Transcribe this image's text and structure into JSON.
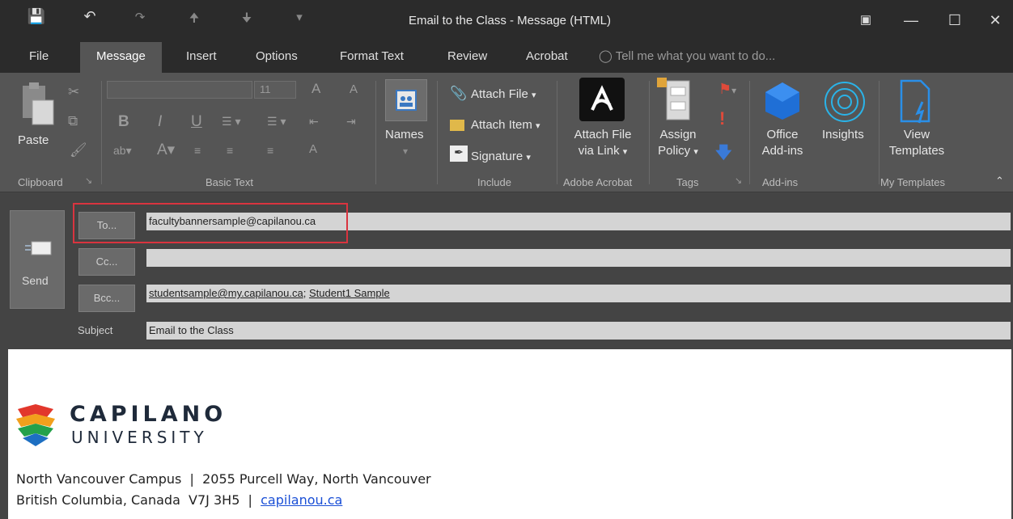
{
  "window": {
    "title": "Email to the Class - Message (HTML)",
    "quick_access": {
      "save": "save-icon",
      "undo": "undo-icon",
      "redo": "redo-icon",
      "up": "up-arrow-icon",
      "down": "down-arrow-icon",
      "more": "customize-icon"
    }
  },
  "tabs": [
    {
      "label": "File"
    },
    {
      "label": "Message",
      "active": true
    },
    {
      "label": "Insert"
    },
    {
      "label": "Options"
    },
    {
      "label": "Format Text"
    },
    {
      "label": "Review"
    },
    {
      "label": "Acrobat"
    }
  ],
  "tell_me": "Tell me what you want to do...",
  "ribbon": {
    "clipboard": {
      "paste": "Paste",
      "group": "Clipboard"
    },
    "basic_text": {
      "font_size": "11",
      "bold": "B",
      "italic": "I",
      "underline": "U",
      "grow": "A",
      "shrink": "A",
      "group": "Basic Text"
    },
    "names": {
      "label": "Names"
    },
    "include": {
      "attach_file": "Attach File",
      "attach_item": "Attach Item",
      "signature": "Signature",
      "group": "Include"
    },
    "adobe": {
      "label_line1": "Attach File",
      "label_line2": "via Link",
      "group": "Adobe Acrobat"
    },
    "tags": {
      "assign_line1": "Assign",
      "assign_line2": "Policy",
      "group": "Tags"
    },
    "addins": {
      "office_line1": "Office",
      "office_line2": "Add-ins",
      "insights": "Insights",
      "group": "Add-ins"
    },
    "templates": {
      "view_line1": "View",
      "view_line2": "Templates",
      "group": "My Templates"
    }
  },
  "compose": {
    "send": "Send",
    "to_label": "To...",
    "cc_label": "Cc...",
    "bcc_label": "Bcc...",
    "subject_label": "Subject",
    "to_value": "facultybannersample@capilanou.ca",
    "cc_value": "",
    "bcc_value_1": "studentsample@my.capilanou.ca",
    "bcc_value_2": "Student1 Sample",
    "subject_value": "Email to the Class"
  },
  "body": {
    "logo_line1": "CAPILANO",
    "logo_line2": "UNIVERSITY",
    "address_line1": "North Vancouver Campus  |  2055 Purcell Way, North Vancouver",
    "address_line2_text": "British Columbia, Canada  V7J 3H5  |  ",
    "website": "capilanou.ca"
  },
  "colors": {
    "highlight": "#d9343f",
    "link": "#1a4fd6"
  }
}
